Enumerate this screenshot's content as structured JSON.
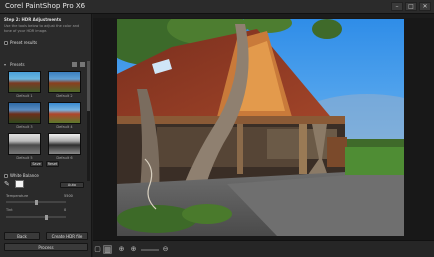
{
  "app": {
    "title": "Corel PaintShop Pro X6",
    "window_buttons": [
      "–",
      "□",
      "✕"
    ]
  },
  "left_panel": {
    "step_title": "Step 2: HDR Adjustments",
    "instructions": "Use the tools below to adjust the color and tone of your HDR image.",
    "preset_results_label": "Preset results",
    "presets_label": "Presets",
    "presets": [
      {
        "label": "Default 1"
      },
      {
        "label": "Default 2"
      },
      {
        "label": "Default 3"
      },
      {
        "label": "Default 4"
      },
      {
        "label": "Default 5"
      },
      {
        "label": "Default 6"
      }
    ],
    "save_button": "Save",
    "reset_button": "Reset",
    "white_balance_label": "White Balance",
    "auto_button": "Auto",
    "temperature_label": "Temperature",
    "temperature_value": "5500",
    "tint_label": "Tint",
    "tint_value": "0",
    "back_button": "Back",
    "create_hdr_button": "Create HDR file",
    "process_button": "Process"
  },
  "bottom_toolbar": {
    "tools": [
      {
        "icon": "single-view-icon",
        "glyph": "▢"
      },
      {
        "icon": "split-view-icon",
        "glyph": "▥"
      },
      {
        "icon": "zoom-fit-icon",
        "glyph": "⊕"
      },
      {
        "icon": "zoom-in-icon",
        "glyph": "⊕"
      },
      {
        "icon": "zoom-out-icon",
        "glyph": "⊖"
      }
    ]
  }
}
